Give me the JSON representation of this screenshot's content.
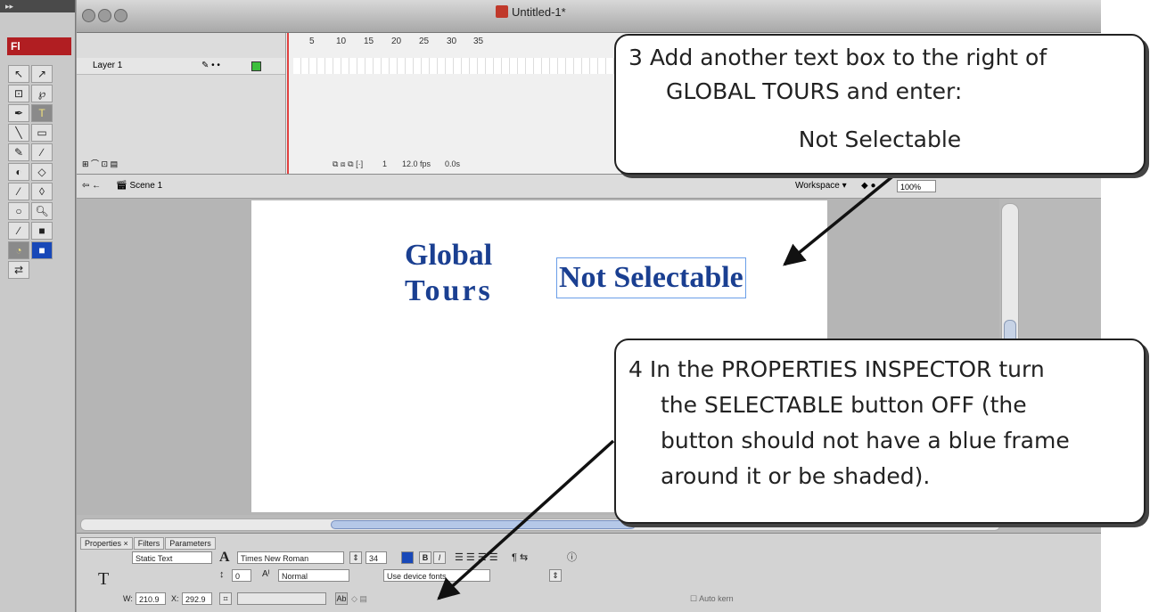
{
  "window": {
    "doc_title": "Untitled-1*"
  },
  "tools": {
    "app_logo": "Fl"
  },
  "timeline": {
    "layer_name": "Layer 1",
    "frame_numbers": [
      "5",
      "10",
      "15",
      "20",
      "25",
      "30",
      "35"
    ],
    "status": {
      "frame": "1",
      "fps": "12.0 fps",
      "time": "0.0s"
    }
  },
  "scene": {
    "name": "Scene 1",
    "workspace_label": "Workspace ▾",
    "zoom": "100%"
  },
  "stage": {
    "global_line1": "Global",
    "global_line2": "Tours",
    "not_selectable": "Not Selectable"
  },
  "properties": {
    "tabs": [
      "Properties ×",
      "Filters",
      "Parameters"
    ],
    "text_type": "Static Text",
    "font": "Times New Roman",
    "font_size": "34",
    "letter_spacing": "0",
    "char_position": "Normal",
    "rendering": "Use device fonts",
    "width_label": "W:",
    "width": "210.9",
    "x_label": "X:",
    "x": "292.9",
    "auto_kern": "Auto kern"
  },
  "callouts": {
    "step3": {
      "line1": "3  Add another text box to the right of",
      "line2": "GLOBAL TOURS and enter:",
      "line3": "Not Selectable"
    },
    "step4": {
      "line1": "4  In the PROPERTIES INSPECTOR turn",
      "line2": "the SELECTABLE button OFF (the",
      "line3": "button should not have a blue frame",
      "line4": "around it or be shaded)."
    }
  },
  "colors": {
    "title_text": "#1a3f91",
    "selection_frame": "#6a9ee8",
    "flash_red": "#b11e22"
  }
}
